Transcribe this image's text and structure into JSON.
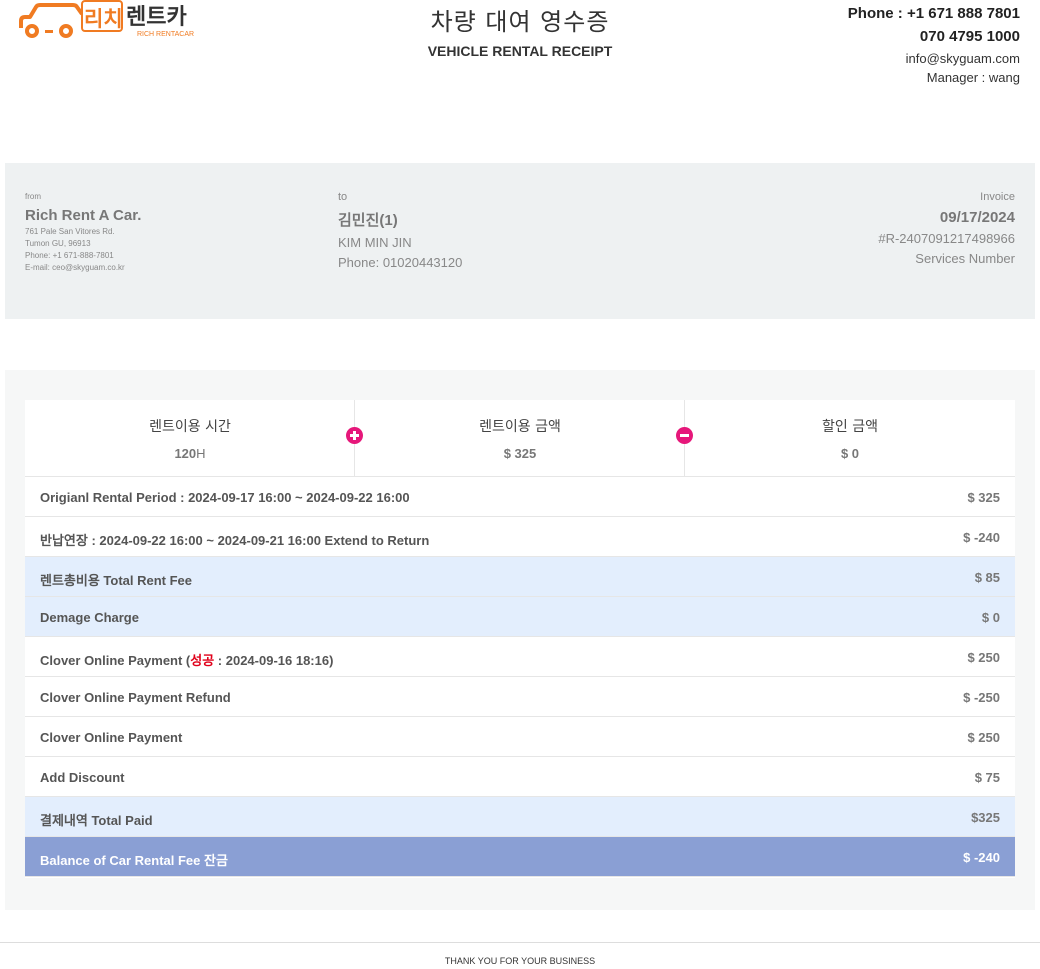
{
  "header": {
    "logo_text_ko": "리치렌트카",
    "logo_text_en": "RICH RENTACAR",
    "title_ko": "차량 대여 영수증",
    "title_en": "VEHICLE RENTAL RECEIPT",
    "phone1": "Phone : +1 671 888 7801",
    "phone2": "070 4795 1000",
    "email": "info@skyguam.com",
    "manager": "Manager : wang"
  },
  "from": {
    "label": "from",
    "name": "Rich Rent A Car.",
    "address1": "761 Pale San Vitores Rd.",
    "address2": "Tumon GU, 96913",
    "phone": "Phone: +1 671-888-7801",
    "email": "E-mail: ceo@skyguam.co.kr"
  },
  "to": {
    "label": "to",
    "name": "김민진(1)",
    "name_en": "KIM MIN JIN",
    "phone": "Phone: 01020443120"
  },
  "invoice": {
    "label": "Invoice",
    "date": "09/17/2024",
    "number": "#R-2407091217498966",
    "services": "Services Number"
  },
  "summary": [
    {
      "label": "렌트이용 시간",
      "value": "120",
      "unit": "H"
    },
    {
      "label": "렌트이용 금액",
      "value": "$ 325"
    },
    {
      "label": "할인 금액",
      "value": "$ 0"
    }
  ],
  "rows": [
    {
      "label": "Origianl Rental Period : 2024-09-17 16:00 ~ 2024-09-22 16:00",
      "amount": "$ 325"
    },
    {
      "label": "반납연장 : 2024-09-22 16:00 ~ 2024-09-21 16:00 Extend to Return",
      "amount": "$ -240"
    },
    {
      "label": "렌트총비용 Total Rent Fee",
      "amount": "$ 85"
    },
    {
      "label": "Demage Charge",
      "amount": "$ 0"
    },
    {
      "label_pre": "Clover Online Payment (",
      "label_status": "성공",
      "label_post": " : 2024-09-16 18:16)",
      "amount": "$ 250"
    },
    {
      "label": "Clover Online Payment Refund",
      "amount": "$ -250"
    },
    {
      "label": "Clover Online Payment",
      "amount": "$ 250"
    },
    {
      "label": "Add Discount",
      "amount": "$ 75"
    },
    {
      "label": "결제내역 Total Paid",
      "amount": "$325"
    },
    {
      "label": "Balance of Car Rental Fee 잔금",
      "amount": "$ -240"
    }
  ],
  "footer": "THANK YOU FOR YOUR BUSINESS",
  "colors": {
    "brand_orange": "#f07b22",
    "accent_pink": "#e6177a",
    "highlight_blue": "#e3eefd",
    "balance_blue": "#8a9fd4",
    "status_red": "#e0001a"
  }
}
